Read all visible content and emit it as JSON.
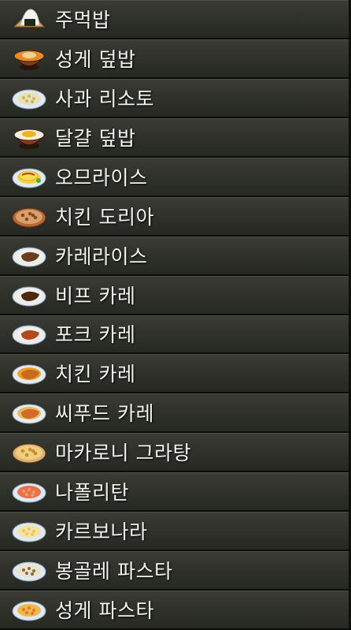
{
  "menu": {
    "items": [
      {
        "label": "주먹밥",
        "icon": "onigiri-icon",
        "colors": {
          "rim": "#c9a063",
          "food": "#f5f5f0",
          "accent": "#1f2a1c"
        }
      },
      {
        "label": "성게 덮밥",
        "icon": "sea-urchin-rice-bowl-icon",
        "colors": {
          "rim": "#7a3e1e",
          "food": "#e58b2a",
          "accent": "#f3d08a"
        }
      },
      {
        "label": "사과 리소토",
        "icon": "apple-risotto-icon",
        "colors": {
          "rim": "#dfe9f3",
          "food": "#e9e1b2",
          "accent": "#c9b46a"
        }
      },
      {
        "label": "달걀 덮밥",
        "icon": "egg-rice-bowl-icon",
        "colors": {
          "rim": "#8a3b1f",
          "food": "#f6efe0",
          "accent": "#f0b21e"
        }
      },
      {
        "label": "오므라이스",
        "icon": "omurice-icon",
        "colors": {
          "rim": "#dfe9f3",
          "food": "#f5d03a",
          "accent": "#5aa63a"
        }
      },
      {
        "label": "치킨 도리아",
        "icon": "chicken-doria-icon",
        "colors": {
          "rim": "#b8663a",
          "food": "#d9a06a",
          "accent": "#8a4a22"
        }
      },
      {
        "label": "카레라이스",
        "icon": "curry-rice-icon",
        "colors": {
          "rim": "#e8ecef",
          "food": "#f4f1e6",
          "accent": "#6b3d1f"
        }
      },
      {
        "label": "비프 카레",
        "icon": "beef-curry-icon",
        "colors": {
          "rim": "#e8ecef",
          "food": "#f4f1e6",
          "accent": "#4f2814"
        }
      },
      {
        "label": "포크 카레",
        "icon": "pork-curry-icon",
        "colors": {
          "rim": "#e8ecef",
          "food": "#f4f1e6",
          "accent": "#b24a1e"
        }
      },
      {
        "label": "치킨 카레",
        "icon": "chicken-curry-icon",
        "colors": {
          "rim": "#e8ecef",
          "food": "#e8a12e",
          "accent": "#c86a1a"
        }
      },
      {
        "label": "씨푸드 카레",
        "icon": "seafood-curry-icon",
        "colors": {
          "rim": "#e8ecef",
          "food": "#e6b860",
          "accent": "#d36a2a"
        }
      },
      {
        "label": "마카로니 그라탕",
        "icon": "macaroni-gratin-icon",
        "colors": {
          "rim": "#d8b07a",
          "food": "#f1cf7a",
          "accent": "#c68d38"
        }
      },
      {
        "label": "나폴리탄",
        "icon": "napolitan-icon",
        "colors": {
          "rim": "#dfe9f3",
          "food": "#e9704a",
          "accent": "#f0a06a"
        }
      },
      {
        "label": "카르보나라",
        "icon": "carbonara-icon",
        "colors": {
          "rim": "#dfe9f3",
          "food": "#f4e3a0",
          "accent": "#e8c760"
        }
      },
      {
        "label": "봉골레 파스타",
        "icon": "vongole-pasta-icon",
        "colors": {
          "rim": "#dfe9f3",
          "food": "#efe3c3",
          "accent": "#7a6a56"
        }
      },
      {
        "label": "성게 파스타",
        "icon": "sea-urchin-pasta-icon",
        "colors": {
          "rim": "#dfe9f3",
          "food": "#f0b84a",
          "accent": "#e07a2a"
        }
      }
    ]
  }
}
